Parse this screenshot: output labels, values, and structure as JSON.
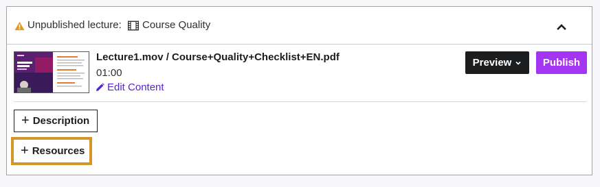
{
  "header": {
    "status_label": "Unpublished lecture:",
    "course_title": "Course Quality",
    "warning_color": "#e59819",
    "icons": {
      "warning": "warning-triangle-icon",
      "film": "film-icon",
      "collapse": "chevron-up-icon"
    }
  },
  "lecture": {
    "title": "Lecture1.mov / Course+Quality+Checklist+EN.pdf",
    "duration": "01:00",
    "edit_label": "Edit Content"
  },
  "actions": {
    "preview_label": "Preview",
    "publish_label": "Publish",
    "publish_color": "#a435f0"
  },
  "sections": {
    "description_label": "Description",
    "resources_label": "Resources",
    "highlight_color": "#d4952b"
  }
}
